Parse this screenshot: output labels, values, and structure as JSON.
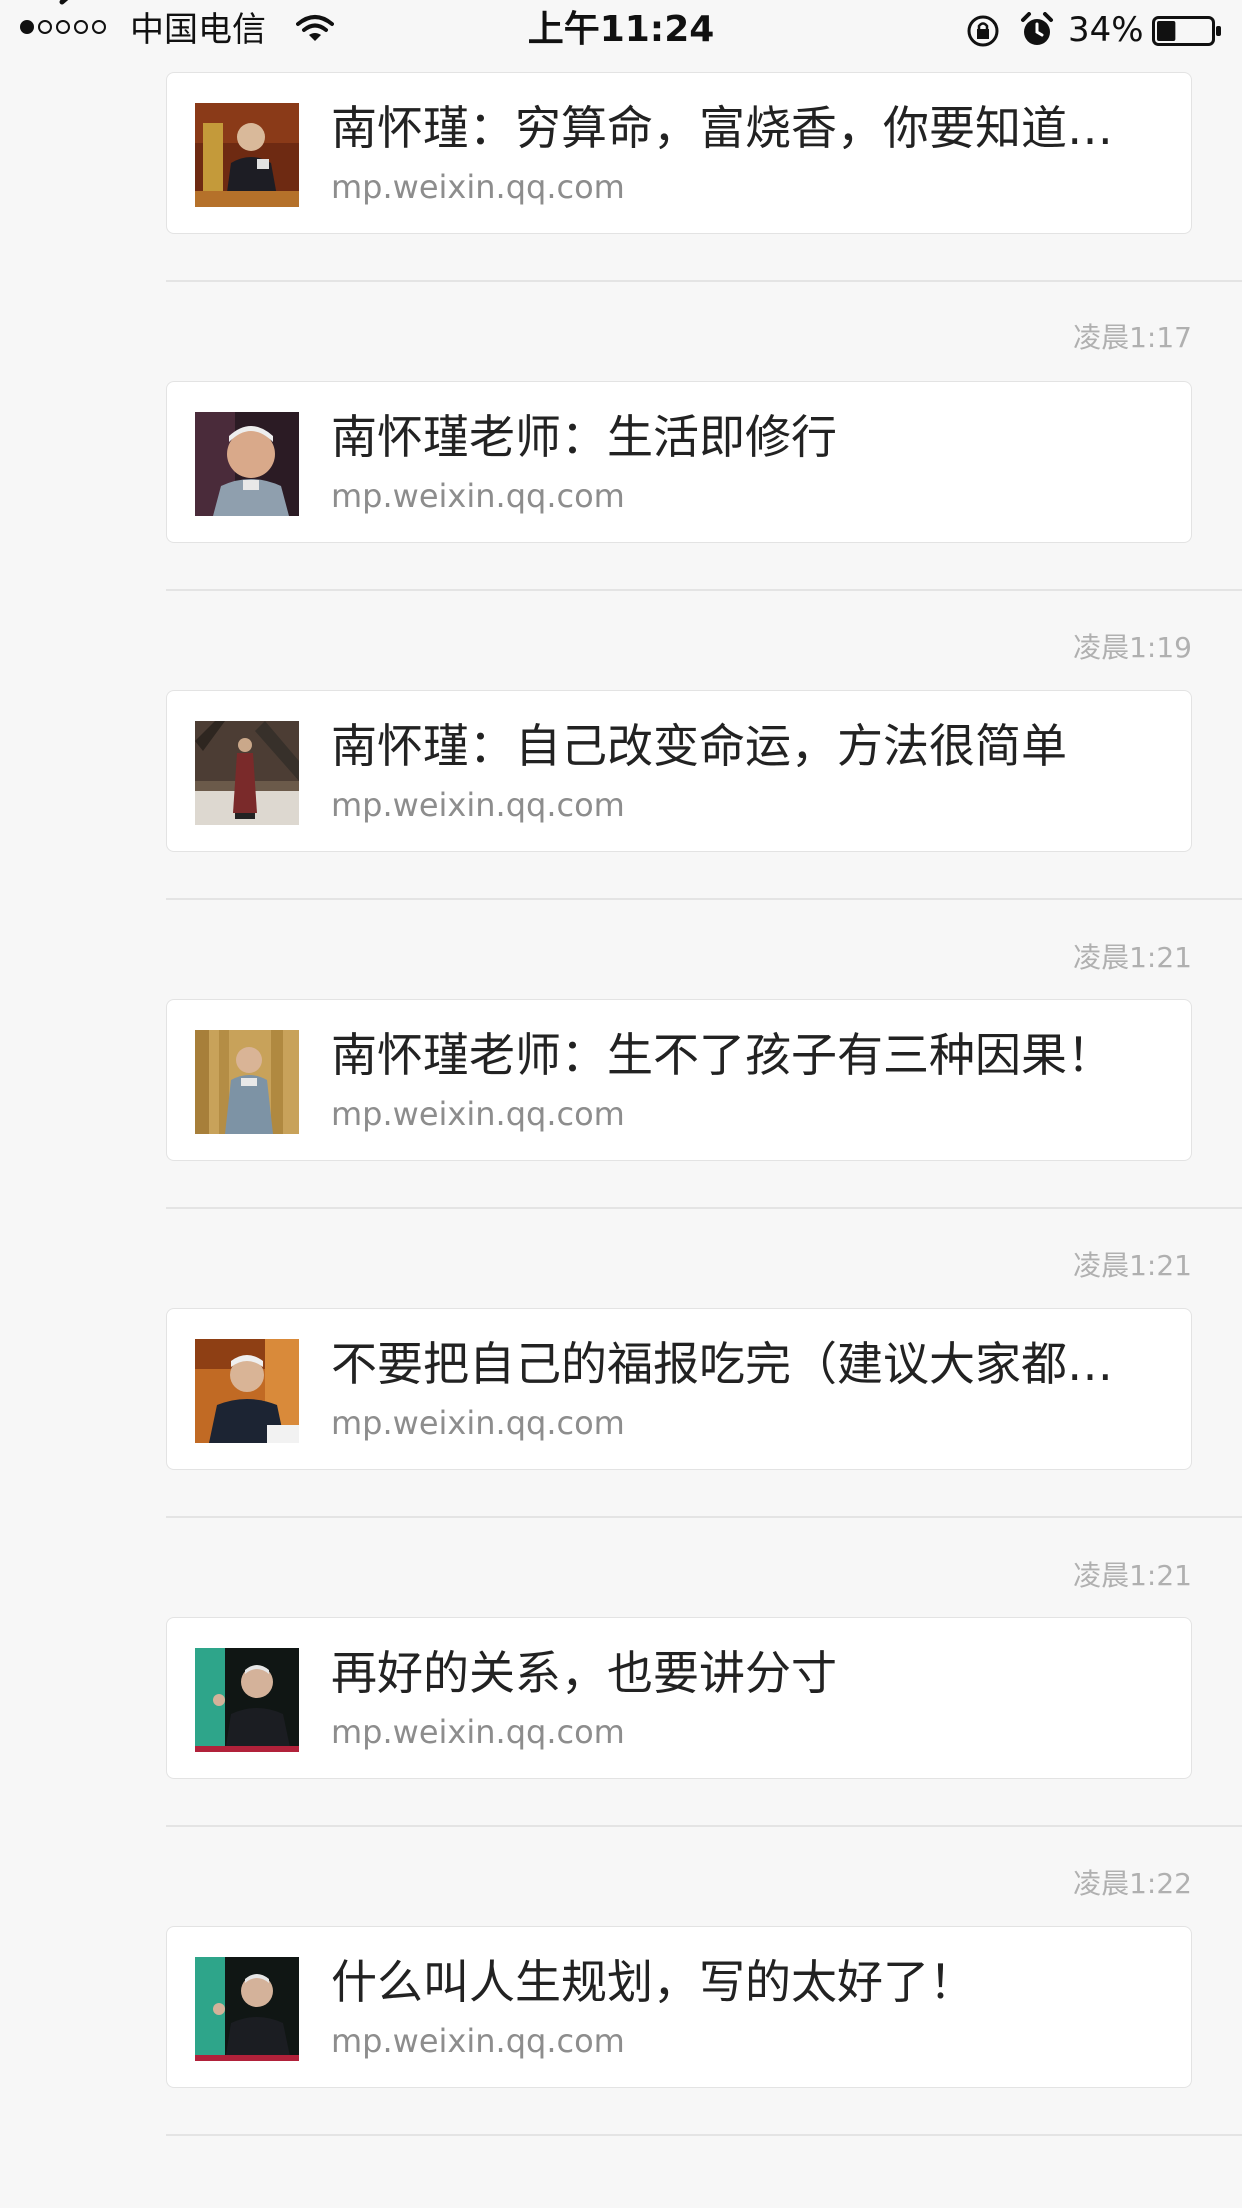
{
  "status_bar": {
    "carrier": "中国电信",
    "time": "上午11:24",
    "battery": "34%",
    "battery_level": 0.34
  },
  "messages": [
    {
      "time": "",
      "title": "南怀瑾：穷算命，富烧香，你要知道…",
      "domain": "mp.weixin.qq.com"
    },
    {
      "time": "凌晨1:17",
      "title": "南怀瑾老师：生活即修行",
      "domain": "mp.weixin.qq.com"
    },
    {
      "time": "凌晨1:19",
      "title": "南怀瑾：自己改变命运，方法很简单",
      "domain": "mp.weixin.qq.com"
    },
    {
      "time": "凌晨1:21",
      "title": "南怀瑾老师：生不了孩子有三种因果！",
      "domain": "mp.weixin.qq.com"
    },
    {
      "time": "凌晨1:21",
      "title": "不要把自己的福报吃完（建议大家都…",
      "domain": "mp.weixin.qq.com"
    },
    {
      "time": "凌晨1:21",
      "title": "再好的关系，也要讲分寸",
      "domain": "mp.weixin.qq.com"
    },
    {
      "time": "凌晨1:22",
      "title": "什么叫人生规划，写的太好了！",
      "domain": "mp.weixin.qq.com"
    }
  ]
}
